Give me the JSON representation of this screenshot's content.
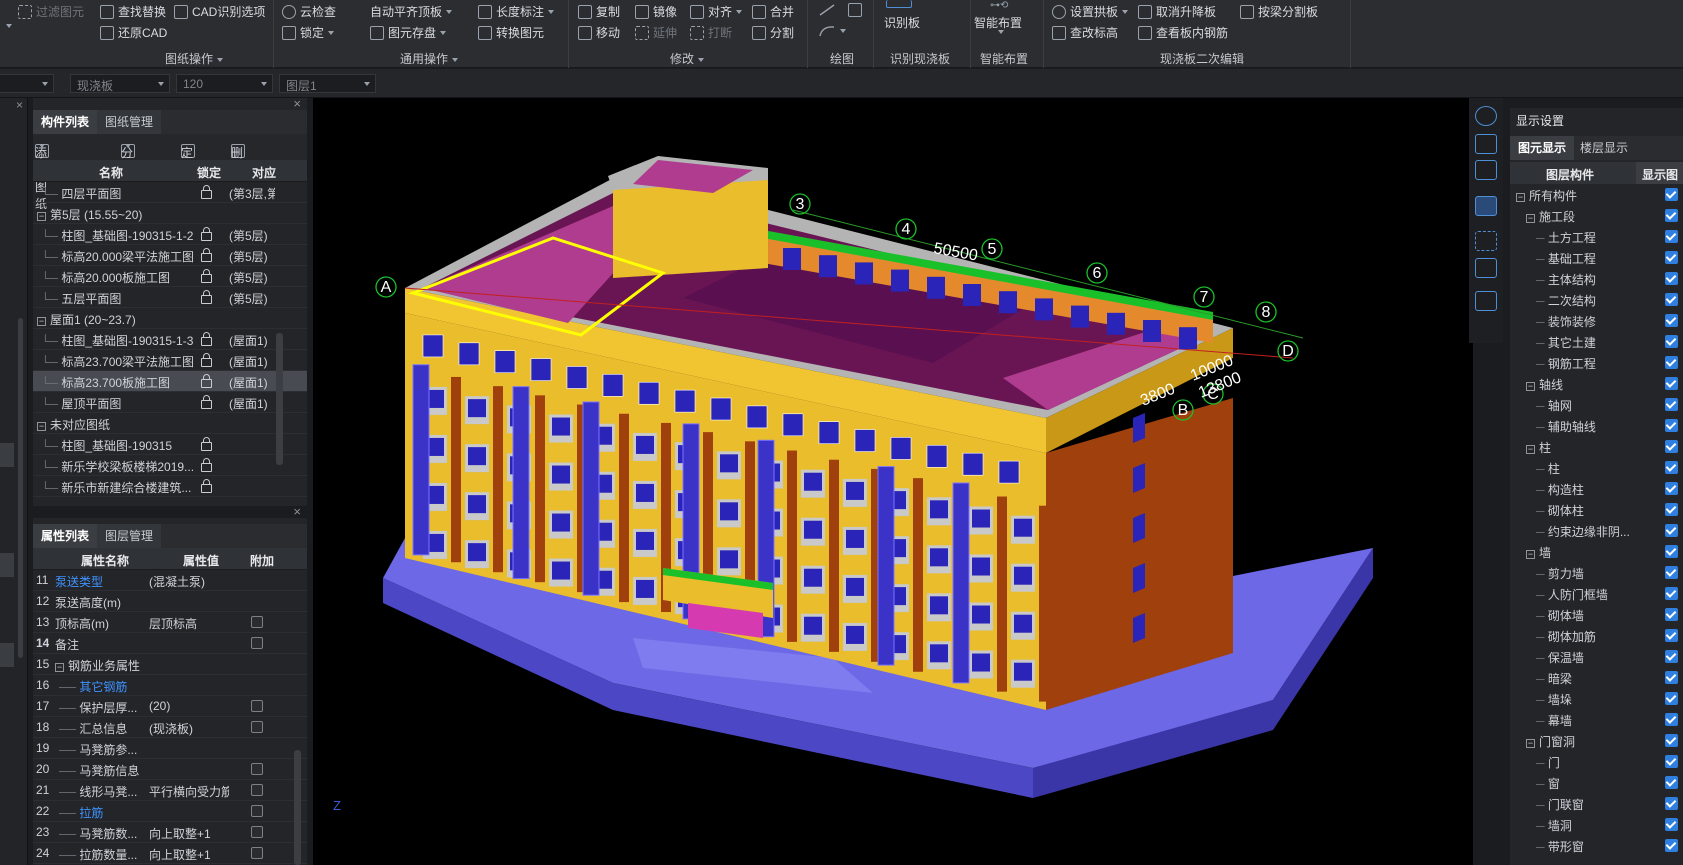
{
  "ribbon": {
    "items": {
      "filter_element": "过滤图元",
      "find_replace": "查找替换",
      "cad_recog_options": "CAD识别选项",
      "restore_cad": "还原CAD",
      "cloud_check": "云检查",
      "auto_level_slab": "自动平齐顶板",
      "lock": "锁定",
      "element_save": "图元存盘",
      "length_dim": "长度标注",
      "convert_element": "转换图元",
      "copy": "复制",
      "mirror": "镜像",
      "align": "对齐",
      "merge": "合并",
      "move": "移动",
      "extend": "延伸",
      "break": "打断",
      "split": "分割",
      "recognize_slab": "识别板",
      "smart_layout": "智能布置",
      "set_arch_slab": "设置拱板",
      "cancel_lift_slab": "取消升降板",
      "split_by_beam": "按梁分割板",
      "check_elevation": "查改标高",
      "view_slab_rebar": "查看板内钢筋"
    },
    "groups": {
      "drawing_ops": "图纸操作",
      "general_ops": "通用操作",
      "modify": "修改",
      "draw": "绘图",
      "recognize_cast_slab": "识别现浇板",
      "smart_layout": "智能布置",
      "cast_slab_edit": "现浇板二次编辑"
    }
  },
  "subbar": {
    "combo1": "现浇板",
    "combo2": "120",
    "combo3": "图层1"
  },
  "component_panel": {
    "tabs": [
      "构件列表",
      "图纸管理"
    ],
    "toolbar": {
      "add_drawing": "添加图纸",
      "split": "分割",
      "locate": "定位",
      "delete": "删除"
    },
    "columns": {
      "name": "名称",
      "lock": "锁定",
      "match": "对应"
    },
    "rows": [
      {
        "name": "四层平面图",
        "match": "(第3层,第",
        "group": false
      },
      {
        "name": "第5层 (15.55~20)",
        "match": "",
        "group": true
      },
      {
        "name": "柱图_基础图-190315-1-2",
        "match": "(第5层)",
        "group": false
      },
      {
        "name": "标高20.000梁平法施工图",
        "match": "(第5层)",
        "group": false
      },
      {
        "name": "标高20.000板施工图",
        "match": "(第5层)",
        "group": false
      },
      {
        "name": "五层平面图",
        "match": "(第5层)",
        "group": false
      },
      {
        "name": "屋面1 (20~23.7)",
        "match": "",
        "group": true
      },
      {
        "name": "柱图_基础图-190315-1-3",
        "match": "(屋面1)",
        "group": false
      },
      {
        "name": "标高23.700梁平法施工图",
        "match": "(屋面1)",
        "group": false
      },
      {
        "name": "标高23.700板施工图",
        "match": "(屋面1)",
        "group": false,
        "selected": true
      },
      {
        "name": "屋顶平面图",
        "match": "(屋面1)",
        "group": false
      },
      {
        "name": "未对应图纸",
        "match": "",
        "group": true
      },
      {
        "name": "柱图_基础图-190315",
        "match": "",
        "group": false
      },
      {
        "name": "新乐学校梁板楼梯2019...",
        "match": "",
        "group": false
      },
      {
        "name": "新乐市新建综合楼建筑...",
        "match": "",
        "group": false
      }
    ]
  },
  "property_panel": {
    "tabs": [
      "属性列表",
      "图层管理"
    ],
    "columns": {
      "name": "属性名称",
      "value": "属性值",
      "extra": "附加"
    },
    "rows": [
      {
        "no": "11",
        "name": "泵送类型",
        "value": "(混凝土泵)",
        "blue": true,
        "indent": 0,
        "check": false
      },
      {
        "no": "12",
        "name": "泵送高度(m)",
        "value": "",
        "blue": false,
        "indent": 0,
        "check": false
      },
      {
        "no": "13",
        "name": "顶标高(m)",
        "value": "层顶标高",
        "blue": false,
        "indent": 0,
        "check": true
      },
      {
        "no": "14",
        "name": "备注",
        "value": "",
        "blue": false,
        "indent": 0,
        "check": true,
        "bold": true
      },
      {
        "no": "15",
        "name": "钢筋业务属性",
        "value": "",
        "blue": false,
        "indent": 0,
        "check": false,
        "group": true
      },
      {
        "no": "16",
        "name": "其它钢筋",
        "value": "",
        "blue": true,
        "indent": 1,
        "check": false
      },
      {
        "no": "17",
        "name": "保护层厚...",
        "value": "(20)",
        "blue": false,
        "indent": 1,
        "check": true
      },
      {
        "no": "18",
        "name": "汇总信息",
        "value": "(现浇板)",
        "blue": false,
        "indent": 1,
        "check": true
      },
      {
        "no": "19",
        "name": "马凳筋参...",
        "value": "",
        "blue": false,
        "indent": 1,
        "check": false
      },
      {
        "no": "20",
        "name": "马凳筋信息",
        "value": "",
        "blue": false,
        "indent": 1,
        "check": true
      },
      {
        "no": "21",
        "name": "线形马凳...",
        "value": "平行横向受力筋",
        "blue": false,
        "indent": 1,
        "check": true
      },
      {
        "no": "22",
        "name": "拉筋",
        "value": "",
        "blue": true,
        "indent": 1,
        "check": true
      },
      {
        "no": "23",
        "name": "马凳筋数...",
        "value": "向上取整+1",
        "blue": false,
        "indent": 1,
        "check": true
      },
      {
        "no": "24",
        "name": "拉筋数量...",
        "value": "向上取整+1",
        "blue": false,
        "indent": 1,
        "check": true
      }
    ]
  },
  "viewport": {
    "axes": {
      "A": "A",
      "B": "B",
      "C": "C",
      "D": "D",
      "n3": "3",
      "n4": "4",
      "n5": "5",
      "n6": "6",
      "n7": "7",
      "n8": "8"
    },
    "dims": {
      "d1": "50500",
      "d2": "10000",
      "d3": "13800",
      "d4": "3800"
    },
    "z_label": "Z"
  },
  "display_settings": {
    "title": "显示设置",
    "tabs": [
      "图元显示",
      "楼层显示"
    ],
    "columns": {
      "layer": "图层构件",
      "show": "显示图"
    },
    "rows": [
      {
        "label": "所有构件",
        "level": 0,
        "group": true
      },
      {
        "label": "施工段",
        "level": 1,
        "group": true
      },
      {
        "label": "土方工程",
        "level": 2
      },
      {
        "label": "基础工程",
        "level": 2
      },
      {
        "label": "主体结构",
        "level": 2
      },
      {
        "label": "二次结构",
        "level": 2
      },
      {
        "label": "装饰装修",
        "level": 2
      },
      {
        "label": "其它土建",
        "level": 2
      },
      {
        "label": "钢筋工程",
        "level": 2
      },
      {
        "label": "轴线",
        "level": 1,
        "group": true
      },
      {
        "label": "轴网",
        "level": 2
      },
      {
        "label": "辅助轴线",
        "level": 2
      },
      {
        "label": "柱",
        "level": 1,
        "group": true
      },
      {
        "label": "柱",
        "level": 2
      },
      {
        "label": "构造柱",
        "level": 2
      },
      {
        "label": "砌体柱",
        "level": 2
      },
      {
        "label": "约束边缘非阴...",
        "level": 2
      },
      {
        "label": "墙",
        "level": 1,
        "group": true
      },
      {
        "label": "剪力墙",
        "level": 2
      },
      {
        "label": "人防门框墙",
        "level": 2
      },
      {
        "label": "砌体墙",
        "level": 2
      },
      {
        "label": "砌体加筋",
        "level": 2
      },
      {
        "label": "保温墙",
        "level": 2
      },
      {
        "label": "暗梁",
        "level": 2
      },
      {
        "label": "墙垛",
        "level": 2
      },
      {
        "label": "幕墙",
        "level": 2
      },
      {
        "label": "门窗洞",
        "level": 1,
        "group": true
      },
      {
        "label": "门",
        "level": 2
      },
      {
        "label": "窗",
        "level": 2
      },
      {
        "label": "门联窗",
        "level": 2
      },
      {
        "label": "墙洞",
        "level": 2
      },
      {
        "label": "带形窗",
        "level": 2
      }
    ]
  },
  "colors": {
    "facade_yellow": "#e9bd2c",
    "column_blue": "#3b32c8",
    "side_brown": "#a0410d",
    "slab_magenta": "#b03c8f",
    "base_blue": "#6c68e6",
    "accent_check": "#2f7fe0"
  }
}
